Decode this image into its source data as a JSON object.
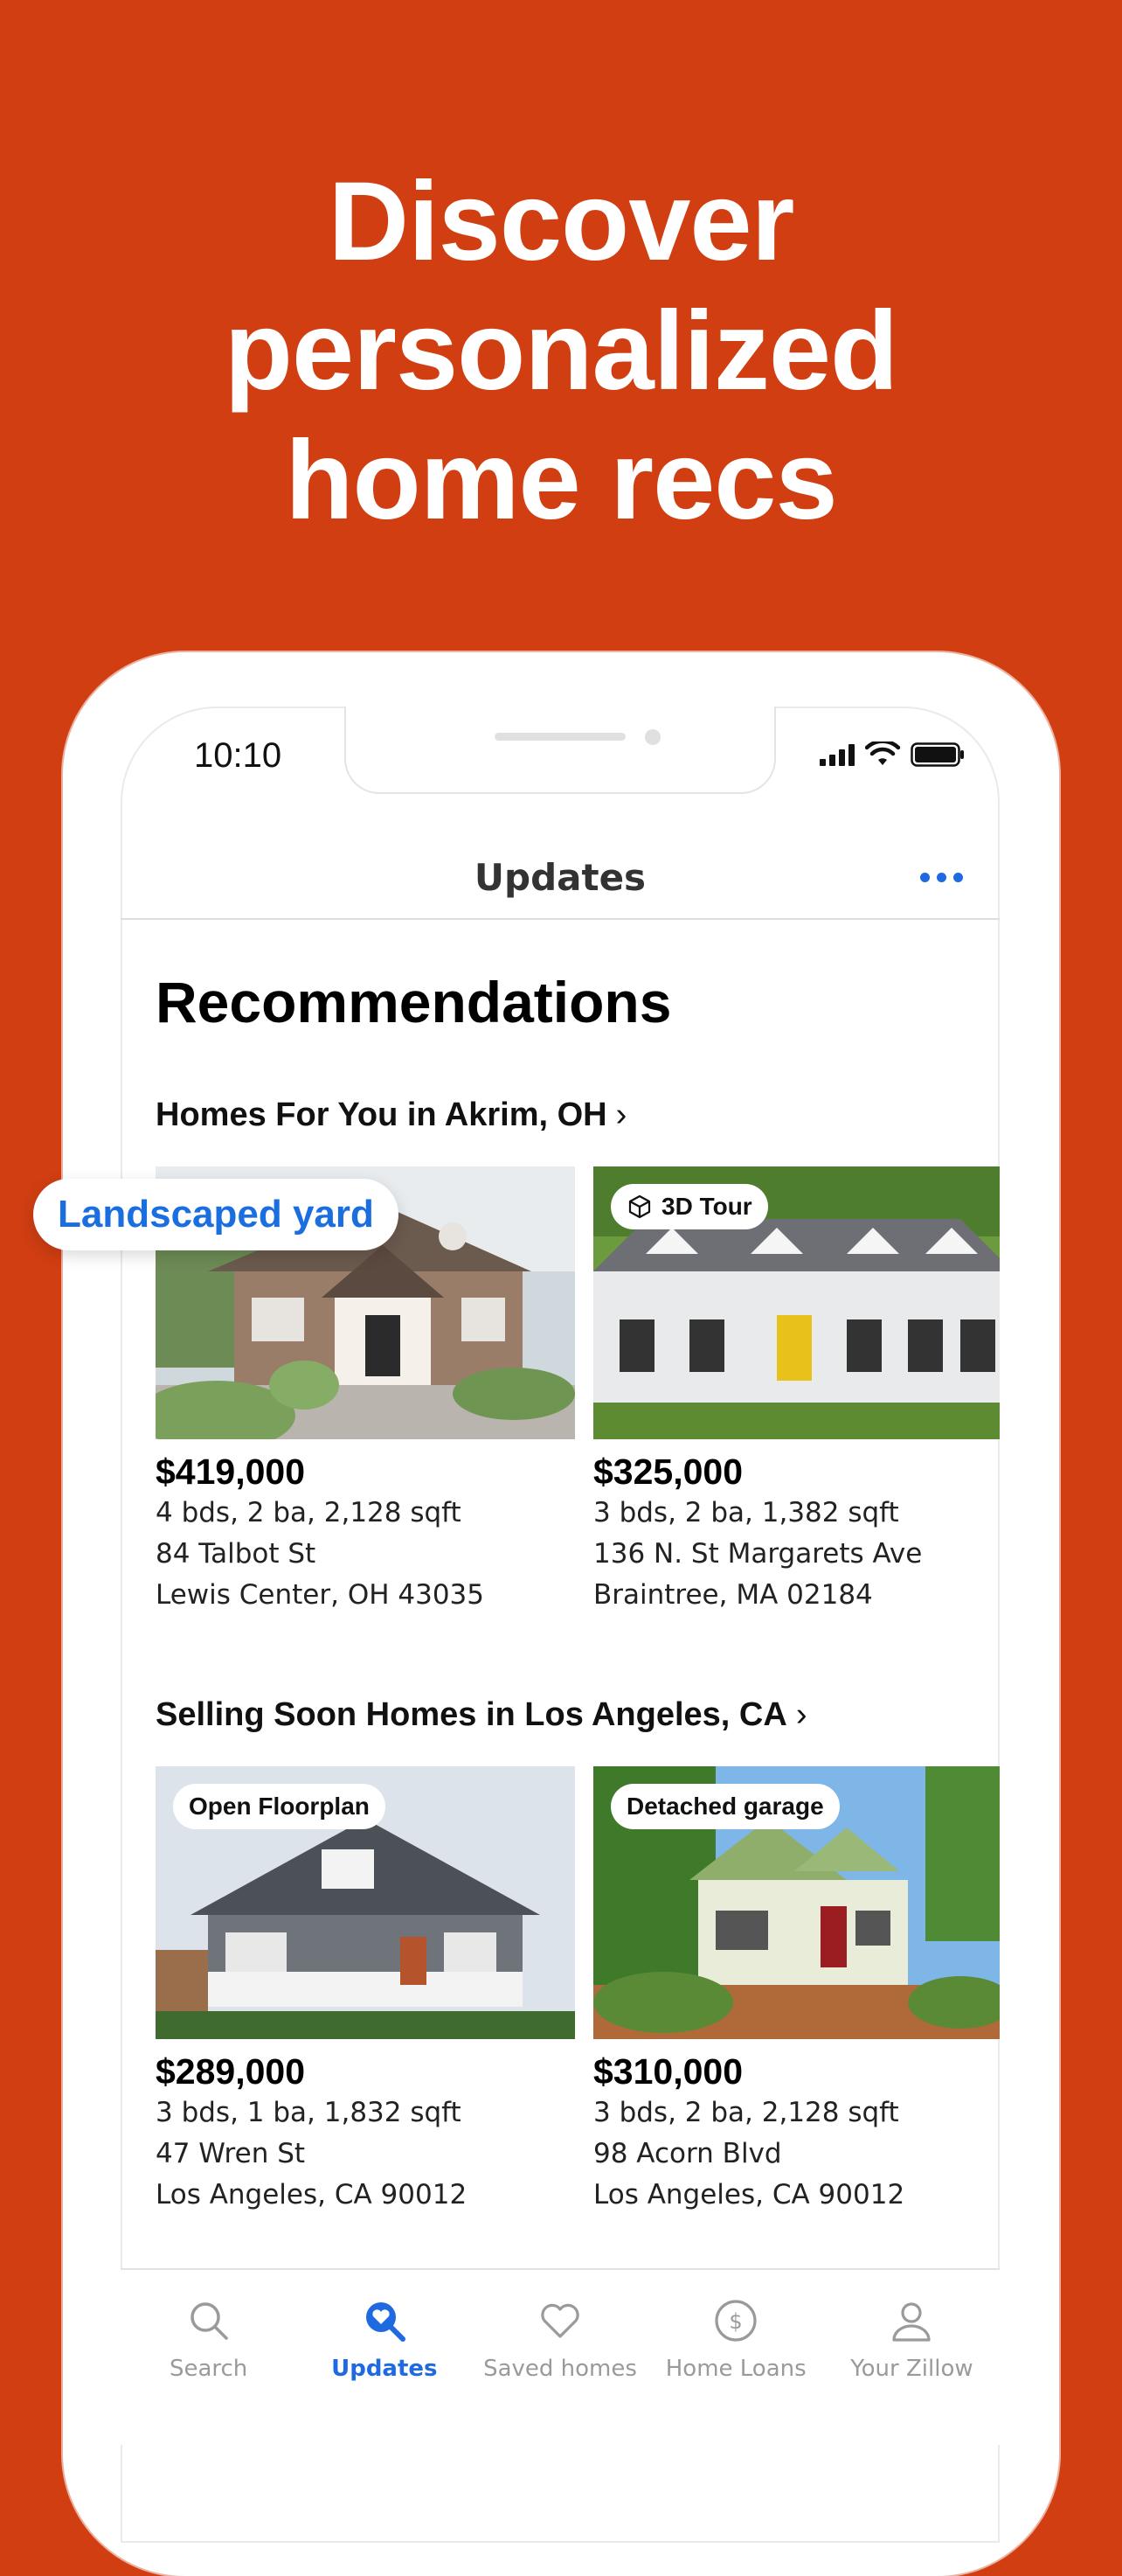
{
  "promo": {
    "headline_lines": [
      "Discover",
      "personalized",
      "home recs"
    ]
  },
  "status_bar": {
    "time": "10:10"
  },
  "header": {
    "title": "Updates",
    "more_icon": "more-dots-icon"
  },
  "main": {
    "title": "Recommendations",
    "floating_tag": "Landscaped yard",
    "sections": [
      {
        "title": "Homes For You in Akrim, OH",
        "cards": [
          {
            "badge": "",
            "price": "$419,000",
            "details": "4 bds, 2 ba, 2,128 sqft",
            "street": "84 Talbot St",
            "city": "Lewis Center, OH 43035"
          },
          {
            "badge": "3D Tour",
            "price": "$325,000",
            "details": "3 bds, 2 ba, 1,382 sqft",
            "street": "136 N. St Margarets Ave",
            "city": "Braintree, MA 02184"
          }
        ]
      },
      {
        "title": "Selling Soon Homes in Los Angeles, CA",
        "cards": [
          {
            "badge": "Open Floorplan",
            "price": "$289,000",
            "details": "3 bds, 1 ba, 1,832 sqft",
            "street": "47 Wren St",
            "city": "Los Angeles, CA 90012"
          },
          {
            "badge": "Detached garage",
            "price": "$310,000",
            "details": "3 bds, 2 ba, 2,128 sqft",
            "street": "98 Acorn Blvd",
            "city": "Los Angeles, CA 90012"
          }
        ]
      }
    ]
  },
  "tabbar": {
    "items": [
      {
        "label": "Search",
        "icon": "search-icon",
        "active": false
      },
      {
        "label": "Updates",
        "icon": "updates-heart-search-icon",
        "active": true
      },
      {
        "label": "Saved homes",
        "icon": "heart-icon",
        "active": false
      },
      {
        "label": "Home Loans",
        "icon": "dollar-circle-icon",
        "active": false
      },
      {
        "label": "Your Zillow",
        "icon": "user-icon",
        "active": false
      }
    ]
  },
  "colors": {
    "background": "#d03e12",
    "accent": "#1f6ae0"
  }
}
